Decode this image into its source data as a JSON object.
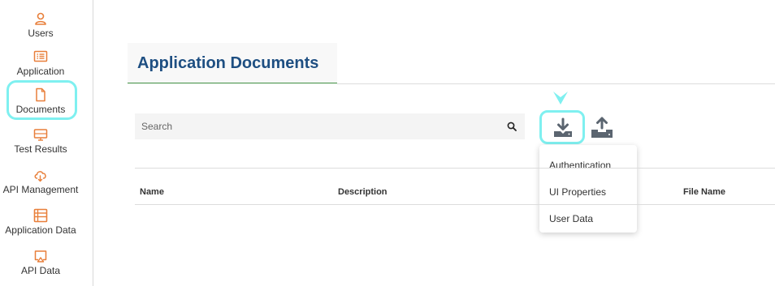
{
  "sidebar": {
    "items": [
      {
        "label": "Users",
        "icon": "user-icon"
      },
      {
        "label": "Application",
        "icon": "list-icon"
      },
      {
        "label": "Documents",
        "icon": "file-icon",
        "active": true
      },
      {
        "label": "Test Results",
        "icon": "monitor-icon"
      },
      {
        "label": "API Management",
        "icon": "cloud-icon"
      },
      {
        "label": "Application Data",
        "icon": "table-icon"
      },
      {
        "label": "API Data",
        "icon": "cast-icon"
      }
    ]
  },
  "page": {
    "title": "Application Documents"
  },
  "search": {
    "placeholder": "Search",
    "value": ""
  },
  "toolbar": {
    "download_icon": "download-icon",
    "upload_icon": "upload-icon"
  },
  "dropdown": {
    "items": [
      "Authentication",
      "UI Properties",
      "User Data"
    ]
  },
  "table": {
    "columns": [
      "Name",
      "Description",
      "File Name"
    ]
  },
  "colors": {
    "accent": "#e87f3a",
    "title": "#1e4f82",
    "highlight": "#7ff0f0",
    "underline": "#3e8e41",
    "icon_gray": "#5b6570"
  }
}
